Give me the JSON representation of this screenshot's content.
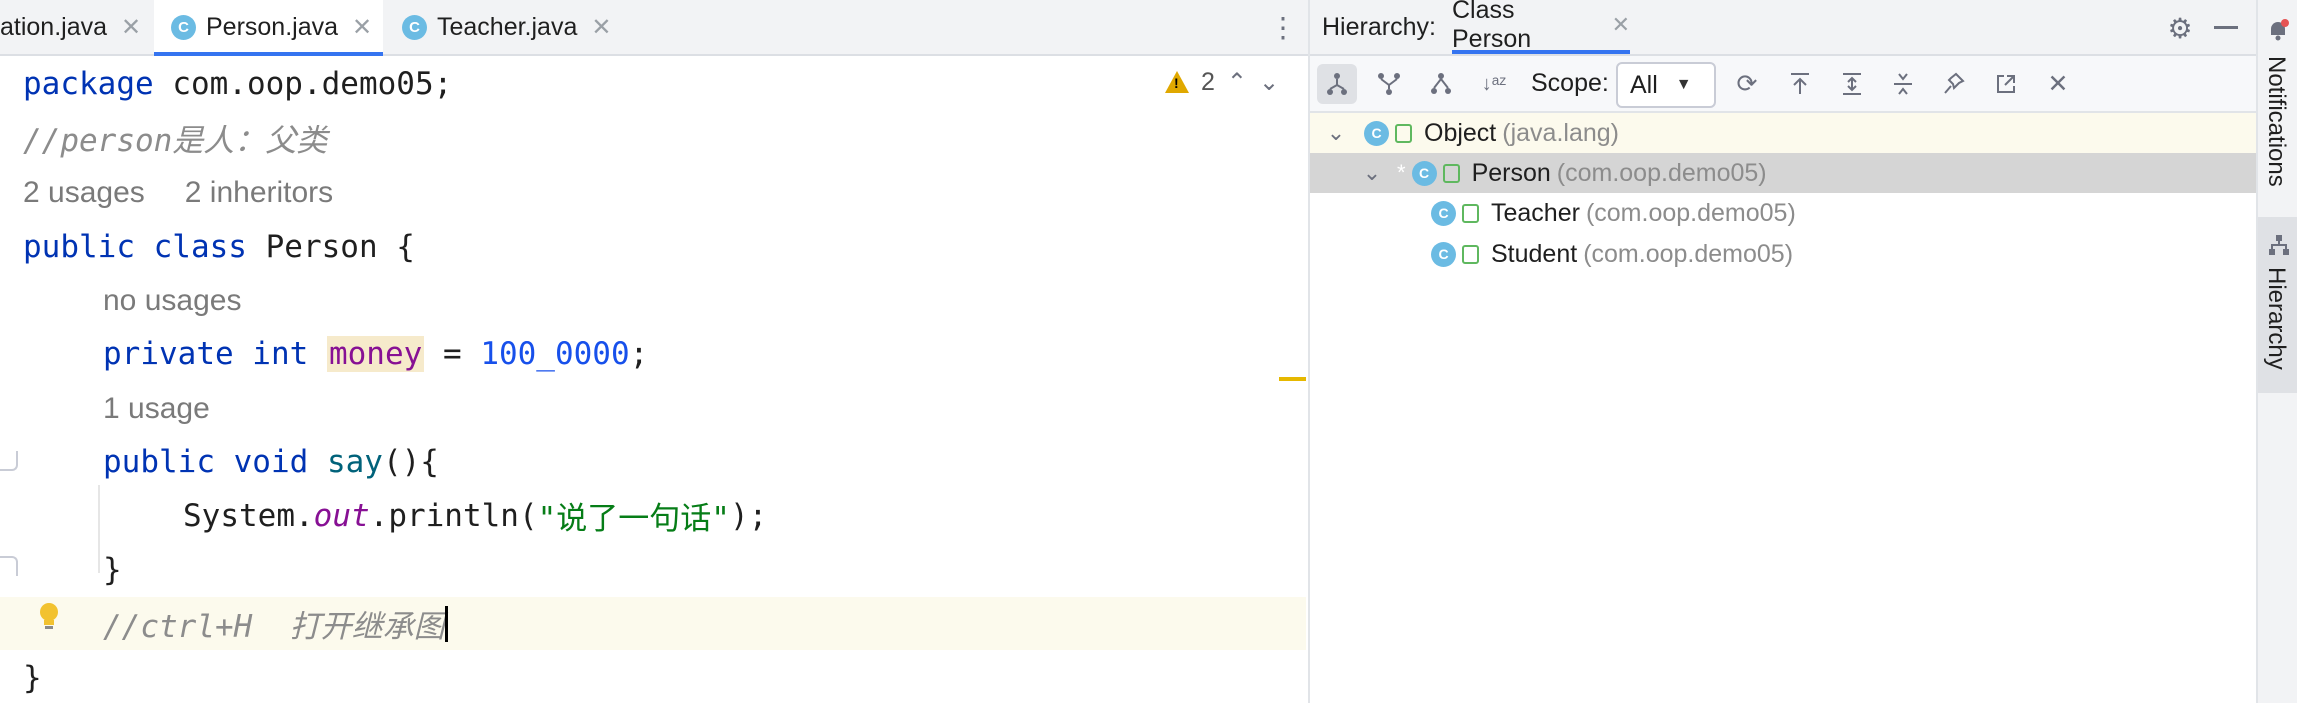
{
  "editor_tabs": [
    {
      "label": "ation.java",
      "icon": "class-icon",
      "active": false
    },
    {
      "label": "Person.java",
      "icon": "class-icon",
      "active": true
    },
    {
      "label": "Teacher.java",
      "icon": "class-icon",
      "active": false
    }
  ],
  "editor": {
    "warning_count": "2",
    "lines": {
      "l1_kw": "package",
      "l1_rest": " com.oop.demo05;",
      "l2_comment": "//person是人：父类",
      "l3_usages": "2 usages",
      "l3_inheritors": "2 inheritors",
      "l4_kw": "public class",
      "l4_rest": " Person {",
      "l5_hint": "no usages",
      "l6_kw": "private int",
      "l6_field": "money",
      "l6_eq": " = ",
      "l6_num": "100_0000",
      "l6_end": ";",
      "l7_hint": "1 usage",
      "l8_kw": "public void",
      "l8_fn": "say",
      "l8_rest": "(){",
      "l9_sys": "System.",
      "l9_out": "out",
      "l9_println": ".println(",
      "l9_str": "\"说了一句话\"",
      "l9_end": ");",
      "l10_brace": "}",
      "l11_comment": "//ctrl+H  打开继承图",
      "l12_brace": "}"
    }
  },
  "hierarchy": {
    "title": "Hierarchy:",
    "tab_label": "Class Person",
    "scope_label": "Scope:",
    "scope_value": "All",
    "tree": [
      {
        "name": "Object",
        "package": "(java.lang)",
        "expanded": true
      },
      {
        "name": "Person",
        "package": "(com.oop.demo05)",
        "expanded": true,
        "selected": true
      },
      {
        "name": "Teacher",
        "package": "(com.oop.demo05)"
      },
      {
        "name": "Student",
        "package": "(com.oop.demo05)"
      }
    ]
  },
  "right_strip": {
    "notifications_label": "Notifications",
    "hierarchy_label": "Hierarchy"
  },
  "colors": {
    "accent": "#3574f0",
    "keyword": "#0033b3",
    "number": "#1750eb",
    "string": "#067d17",
    "comment": "#8c8c8c",
    "class_icon": "#6bbbe3",
    "selected_row": "#d5d5d5",
    "root_row": "#fcfaed"
  }
}
